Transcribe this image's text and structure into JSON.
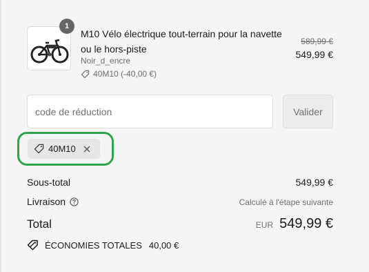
{
  "line_item": {
    "quantity": "1",
    "title": "M10 Vélo électrique tout-terrain pour la navette ou le hors-piste",
    "variant": "Noir_d_encre",
    "discount_text": "40M10 (-40,00 €)",
    "original_price": "589,99 €",
    "price": "549,99 €",
    "image_icon": "electric-bike-image"
  },
  "discount_form": {
    "placeholder": "code de réduction",
    "value": "",
    "apply_label": "Valider"
  },
  "applied_code": {
    "code": "40M10",
    "highlight_color": "#2ea64a"
  },
  "summary": {
    "subtotal_label": "Sous-total",
    "subtotal_value": "549,99 €",
    "shipping_label": "Livraison",
    "shipping_value": "Calculé à l'étape suivante",
    "total_label": "Total",
    "currency": "EUR",
    "total_value": "549,99 €",
    "savings_label": "ÉCONOMIES TOTALES",
    "savings_value": "40,00 €"
  }
}
